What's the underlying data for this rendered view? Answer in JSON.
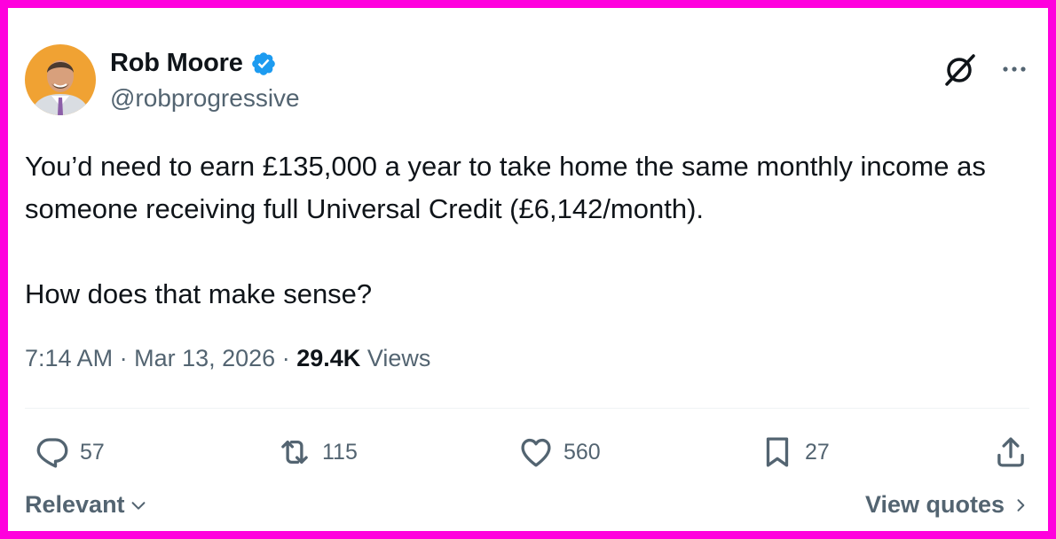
{
  "author": {
    "name": "Rob Moore",
    "handle": "@robprogressive",
    "verified": true
  },
  "post": {
    "paragraphs": [
      "You’d need to earn £135,000 a year to take home the same monthly income as someone receiving full Universal Credit (£6,142/month).",
      "How does that make sense?"
    ],
    "time": "7:14 AM",
    "date": "Mar 13, 2026",
    "views_count": "29.4K",
    "views_label": "Views",
    "separator": "·"
  },
  "engagement": {
    "replies": "57",
    "reposts": "115",
    "likes": "560",
    "bookmarks": "27"
  },
  "footer": {
    "sort_label": "Relevant",
    "quotes_label": "View quotes"
  },
  "colors": {
    "frame": "#ff00dd",
    "verified_badge": "#1d9bf0",
    "secondary_text": "#536471",
    "primary_text": "#0f1419",
    "avatar_bg": "#f0a233"
  },
  "icons": [
    "verified-badge-icon",
    "grok-icon",
    "more-icon",
    "reply-icon",
    "repost-icon",
    "like-icon",
    "bookmark-icon",
    "share-icon",
    "chevron-down-icon",
    "chevron-right-icon"
  ]
}
